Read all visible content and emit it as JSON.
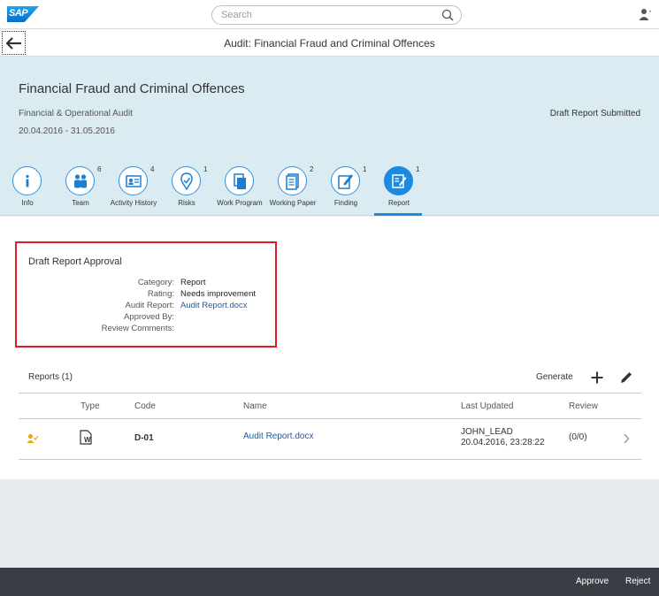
{
  "shell": {
    "logo_text": "SAP",
    "search_placeholder": "Search"
  },
  "titlebar": {
    "title": "Audit: Financial Fraud and Criminal Offences"
  },
  "header": {
    "title": "Financial Fraud and Criminal Offences",
    "subtitle": "Financial & Operational Audit",
    "date_range": "20.04.2016 - 31.05.2016",
    "status": "Draft Report Submitted"
  },
  "tabs": [
    {
      "label": "Info",
      "count": "",
      "icon": "info-icon"
    },
    {
      "label": "Team",
      "count": "6",
      "icon": "team-icon"
    },
    {
      "label": "Activity History",
      "count": "4",
      "icon": "activity-history-icon"
    },
    {
      "label": "Risks",
      "count": "1",
      "icon": "risks-icon"
    },
    {
      "label": "Work Program",
      "count": "",
      "icon": "work-program-icon"
    },
    {
      "label": "Working Paper",
      "count": "2",
      "icon": "working-paper-icon"
    },
    {
      "label": "Finding",
      "count": "1",
      "icon": "finding-icon"
    },
    {
      "label": "Report",
      "count": "1",
      "icon": "report-icon"
    }
  ],
  "approval": {
    "heading": "Draft Report Approval",
    "fields": [
      {
        "label": "Category:",
        "value": "Report"
      },
      {
        "label": "Rating:",
        "value": "Needs improvement"
      },
      {
        "label": "Audit Report:",
        "value": "Audit Report.docx"
      },
      {
        "label": "Approved By:",
        "value": ""
      },
      {
        "label": "Review Comments:",
        "value": ""
      }
    ]
  },
  "reports": {
    "title": "Reports (1)",
    "generate_label": "Generate",
    "columns": [
      "Type",
      "Code",
      "Name",
      "Last Updated",
      "Review"
    ],
    "rows": [
      {
        "type_icon": "word-document-icon",
        "code": "D-01",
        "name": "Audit Report.docx",
        "updated_by": "JOHN_LEAD",
        "updated_at": "20.04.2016, 23:28:22",
        "review": "(0/0)"
      }
    ]
  },
  "footer": {
    "approve_label": "Approve",
    "reject_label": "Reject"
  },
  "colors": {
    "accent": "#1b8ae0",
    "header_bg": "#dbebf2",
    "highlight_border": "#e01d25",
    "footer_bg": "#3a3e44",
    "link": "#1d5ca8"
  }
}
